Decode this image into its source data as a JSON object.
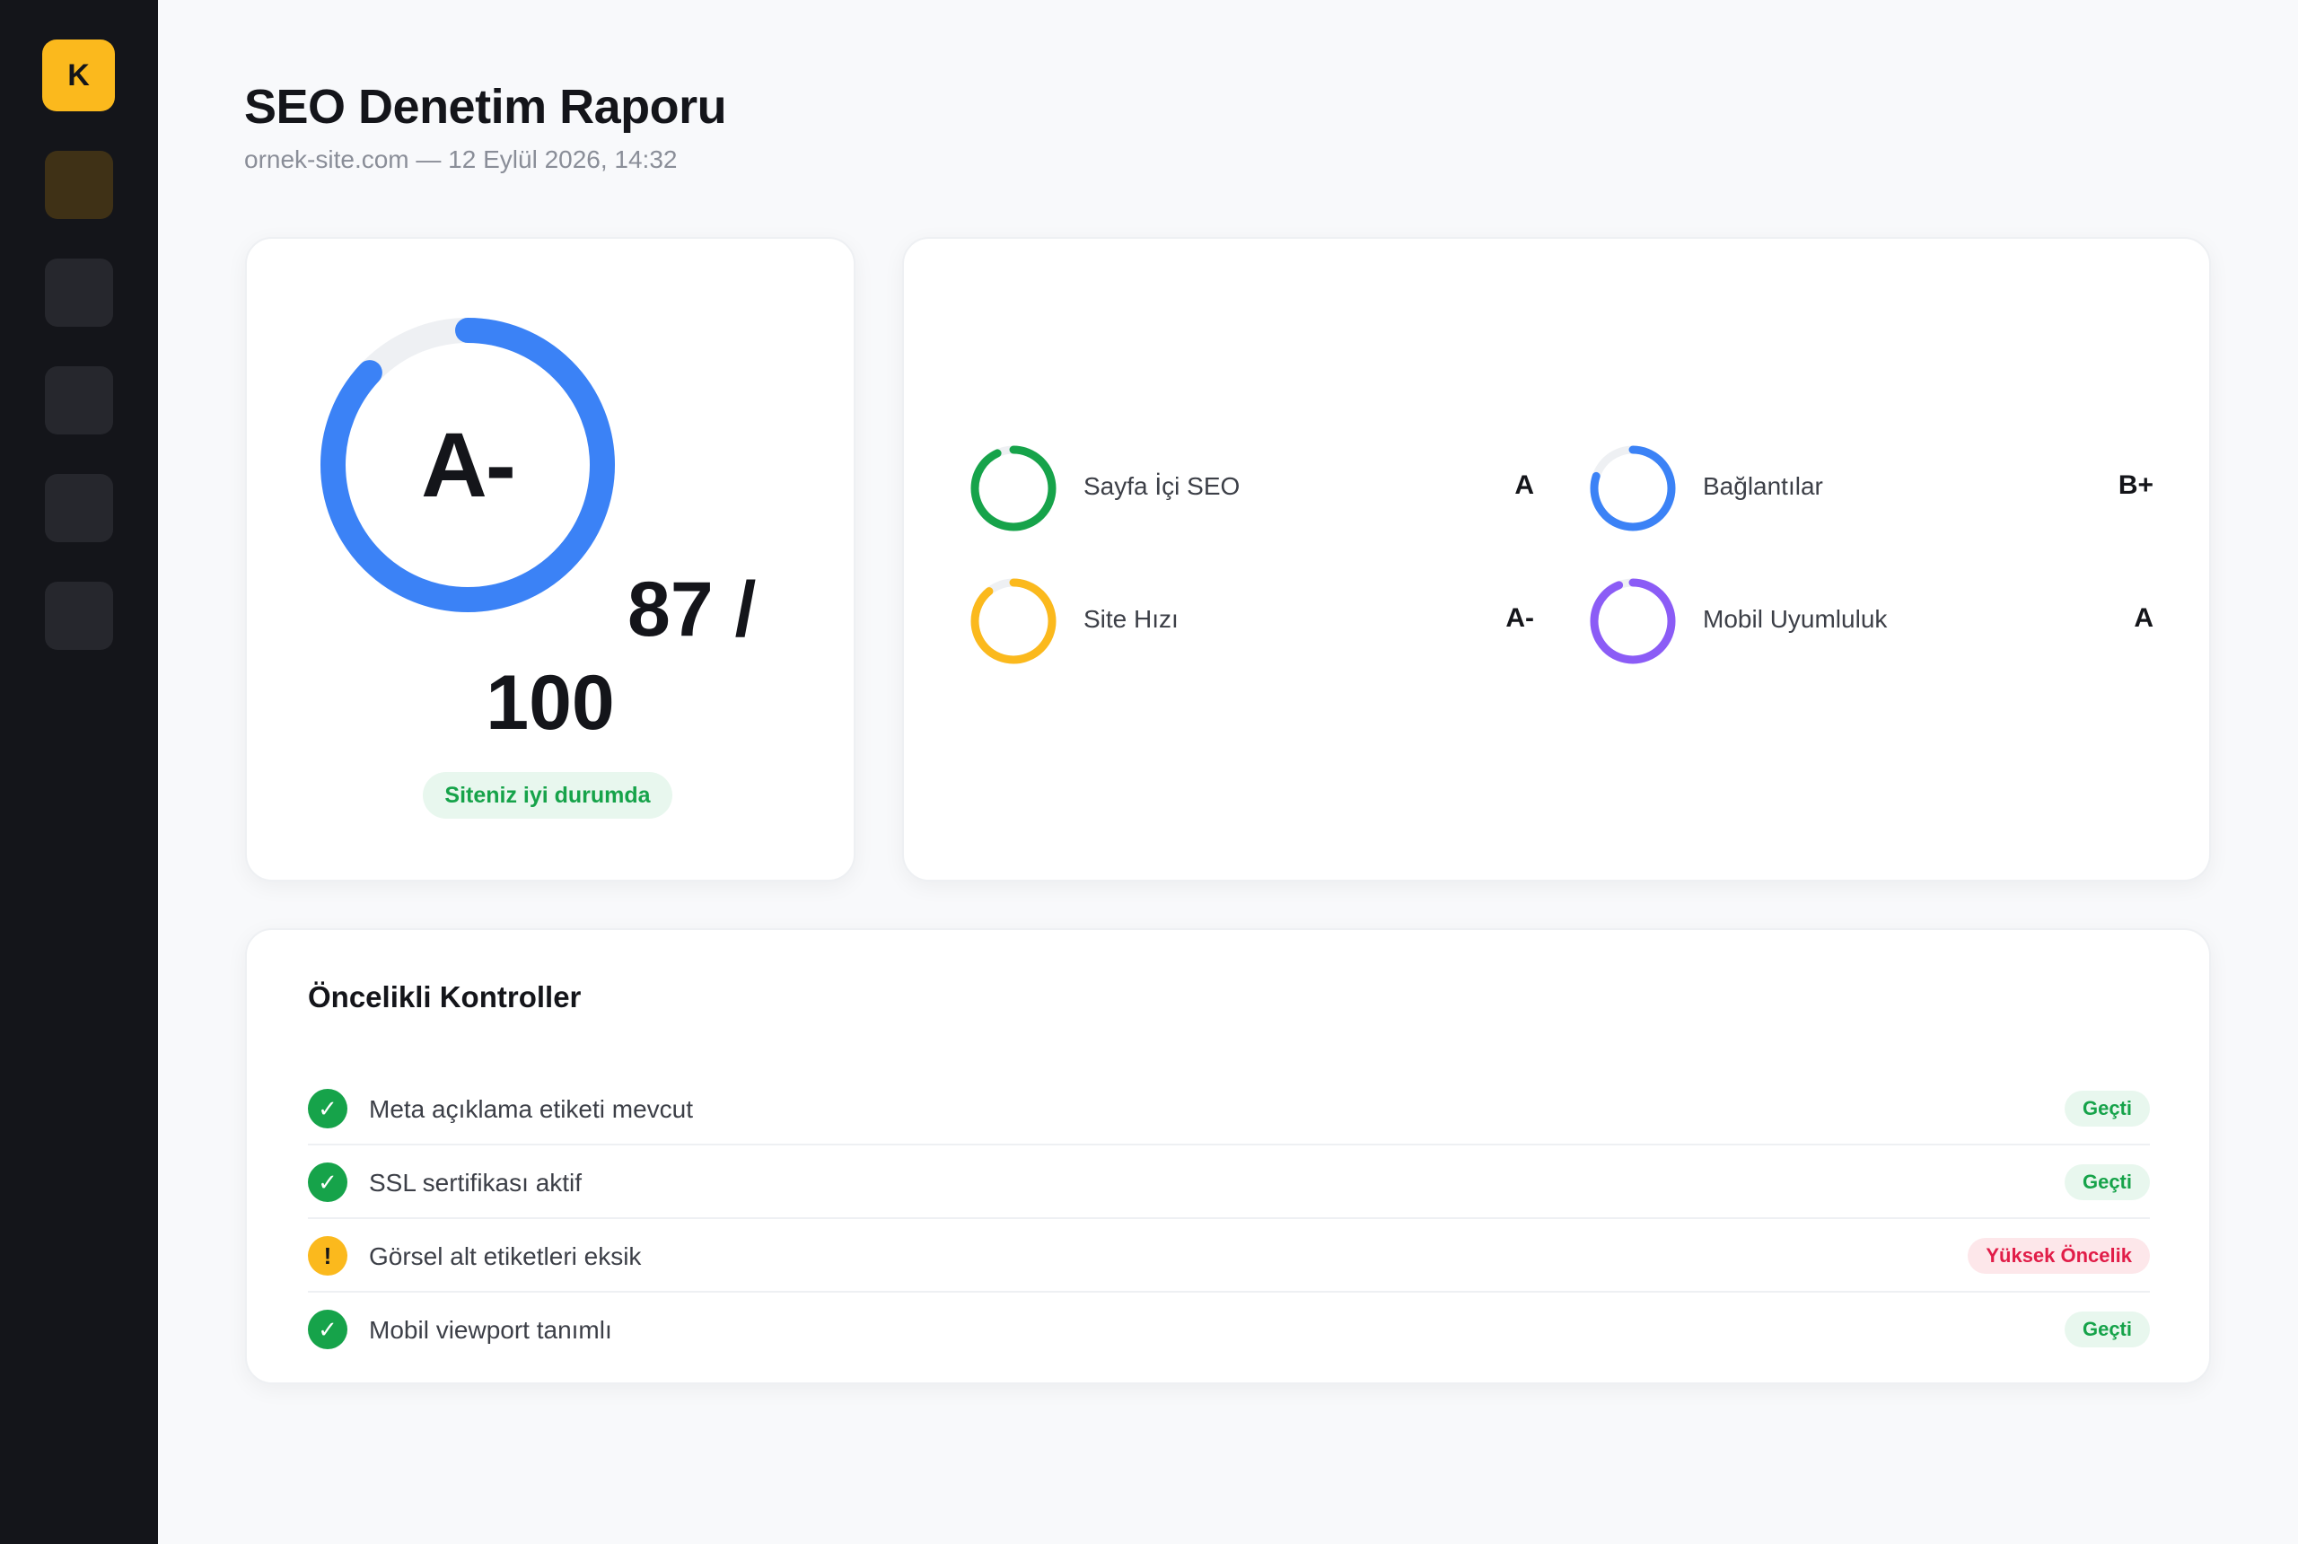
{
  "sidebar": {
    "logo_letter": "K",
    "items": [
      {
        "name": "nav-item-1",
        "active": true
      },
      {
        "name": "nav-item-2",
        "active": false
      },
      {
        "name": "nav-item-3",
        "active": false
      },
      {
        "name": "nav-item-4",
        "active": false
      },
      {
        "name": "nav-item-5",
        "active": false
      }
    ]
  },
  "header": {
    "title": "SEO Denetim Raporu",
    "subtitle": "ornek-site.com — 12 Eylül 2026, 14:32"
  },
  "score": {
    "grade": "A-",
    "value": 87,
    "max": 100,
    "line1": "87 /",
    "line2": "100",
    "status": "Siteniz iyi durumda",
    "ring_color": "#3b82f6"
  },
  "categories": [
    {
      "label": "Sayfa İçi SEO",
      "grade": "A",
      "fraction": 0.93,
      "color": "#16a34a"
    },
    {
      "label": "Bağlantılar",
      "grade": "B+",
      "fraction": 0.8,
      "color": "#3b82f6"
    },
    {
      "label": "Site Hızı",
      "grade": "A-",
      "fraction": 0.89,
      "color": "#fbb91d"
    },
    {
      "label": "Mobil Uyumluluk",
      "grade": "A",
      "fraction": 0.94,
      "color": "#8b5cf6"
    }
  ],
  "checks": {
    "title": "Öncelikli Kontroller",
    "items": [
      {
        "text": "Meta açıklama etiketi mevcut",
        "status": "pass",
        "icon": "✓",
        "badge": "Geçti"
      },
      {
        "text": "SSL sertifikası aktif",
        "status": "pass",
        "icon": "✓",
        "badge": "Geçti"
      },
      {
        "text": "Görsel alt etiketleri eksik",
        "status": "high",
        "icon": "!",
        "badge": "Yüksek Öncelik"
      },
      {
        "text": "Mobil viewport tanımlı",
        "status": "pass",
        "icon": "✓",
        "badge": "Geçti"
      }
    ]
  },
  "colors": {
    "accent": "#fbb91d",
    "ring_track": "#eef0f3",
    "pass": "#16a34a",
    "high": "#e11d48"
  }
}
